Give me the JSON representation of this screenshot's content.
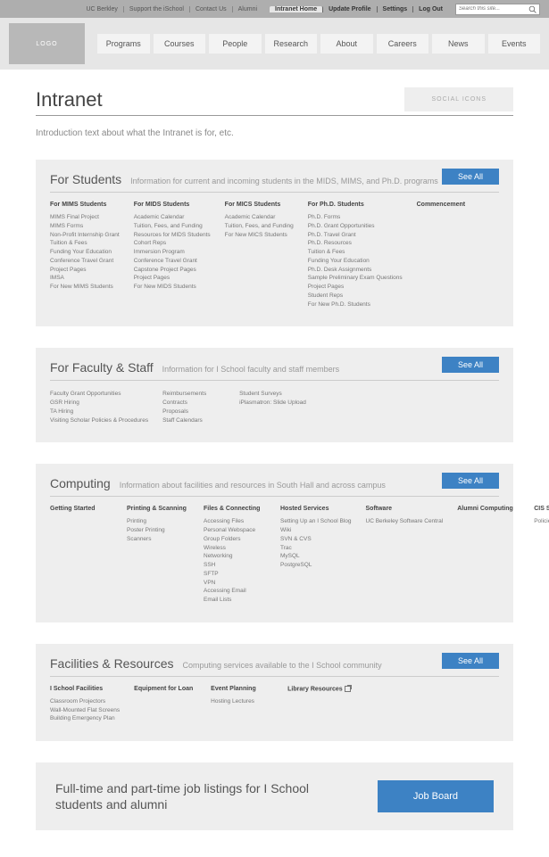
{
  "topbar": {
    "left": [
      "UC Berkley",
      "Support the iSchool",
      "Contact Us",
      "Alumni"
    ],
    "right": [
      "Intranet Home",
      "Update Profile",
      "Settings",
      "Log Out"
    ],
    "search_placeholder": "Search this site..."
  },
  "nav": {
    "logo": "LOGO",
    "tabs": [
      "Programs",
      "Courses",
      "People",
      "Research",
      "About",
      "Careers",
      "News",
      "Events"
    ]
  },
  "page": {
    "title": "Intranet",
    "social": "SOCIAL ICONS",
    "intro": "Introduction text about what the Intranet is for, etc."
  },
  "seeall_label": "See All",
  "students": {
    "title": "For Students",
    "desc": "Information for current and incoming students in the MIDS, MIMS, and Ph.D. programs",
    "cols": [
      {
        "h": "For MIMS Students",
        "items": [
          "MIMS Final Project",
          "MIMS Forms",
          "Non-Profit Internship Grant",
          "Tuition & Fees",
          "Funding Your Education",
          "Conference Travel Grant",
          "Project Pages",
          "IMSA",
          "For New MIMS Students"
        ]
      },
      {
        "h": "For MIDS Students",
        "items": [
          "Academic Calendar",
          "Tuition, Fees, and Funding",
          "Resources for MIDS Students",
          "Cohort Reps",
          "Immersion Program",
          "Conference Travel Grant",
          "Capstone Project Pages",
          "Project Pages",
          "For New MIDS Students"
        ]
      },
      {
        "h": "For MICS Students",
        "items": [
          "Academic Calendar",
          "Tuition, Fees, and Funding",
          "For New MICS Students"
        ]
      },
      {
        "h": "For Ph.D. Students",
        "items": [
          "Ph.D. Forms",
          "Ph.D. Grant Opportunities",
          "Ph.D. Travel Grant",
          "Ph.D. Resources",
          "Tuition & Fees",
          "Funding Your Education",
          "Ph.D. Desk Assignments",
          "Sample Preliminary Exam Questions",
          "Project Pages",
          "Student Reps",
          "For New Ph.D. Students"
        ]
      },
      {
        "h": "Commencement",
        "items": []
      }
    ]
  },
  "faculty": {
    "title": "For Faculty & Staff",
    "desc": "Information for I School faculty and staff members",
    "cols": [
      {
        "h": "",
        "items": [
          "Faculty Grant Opportunities",
          "GSR Hiring",
          "TA Hiring",
          "Visiting Scholar Policies & Procedures"
        ]
      },
      {
        "h": "",
        "items": [
          "Reimbursements",
          "Contracts",
          "Proposals",
          "Staff Calendars"
        ]
      },
      {
        "h": "",
        "items": [
          "Student Surveys",
          "iPlasmatron: Slide Upload"
        ]
      }
    ]
  },
  "computing": {
    "title": "Computing",
    "desc": "Information about facilities and resources in South Hall and across campus",
    "cols": [
      {
        "h": "Getting Started",
        "items": []
      },
      {
        "h": "Printing & Scanning",
        "items": [
          "Printing",
          "Poster Printing",
          "Scanners"
        ]
      },
      {
        "h": "Files & Connecting",
        "items": [
          "Accessing Files",
          "Personal Webspace",
          "Group Folders",
          "Wireless",
          "Networking",
          "SSH",
          "SFTP",
          "VPN",
          "Accessing Email",
          "Email Lists"
        ]
      },
      {
        "h": "Hosted Services",
        "items": [
          "Setting Up an I School Blog",
          "Wiki",
          "SVN & CVS",
          "Trac",
          "MySQL",
          "PostgreSQL"
        ]
      },
      {
        "h": "Software",
        "items": [
          "UC Berkeley Software Central"
        ]
      },
      {
        "h": "Alumni Computing",
        "items": []
      },
      {
        "h": "CIS Service Catalog",
        "items": [
          "Policies"
        ]
      }
    ]
  },
  "facilities": {
    "title": "Facilities & Resources",
    "desc": "Computing services available to the I School community",
    "cols": [
      {
        "h": "I School Facilities",
        "items": [
          "Classroom Projectors",
          "Wall-Mounted Flat Screens",
          "Building Emergency Plan"
        ]
      },
      {
        "h": "Equipment for Loan",
        "items": []
      },
      {
        "h": "Event Planning",
        "items": [
          "Hosting Lectures"
        ]
      },
      {
        "h": "Library Resources",
        "items": [],
        "ext": true
      }
    ]
  },
  "jobs": {
    "text": "Full-time and part-time job listings for I School students and alumni",
    "button": "Job Board"
  }
}
